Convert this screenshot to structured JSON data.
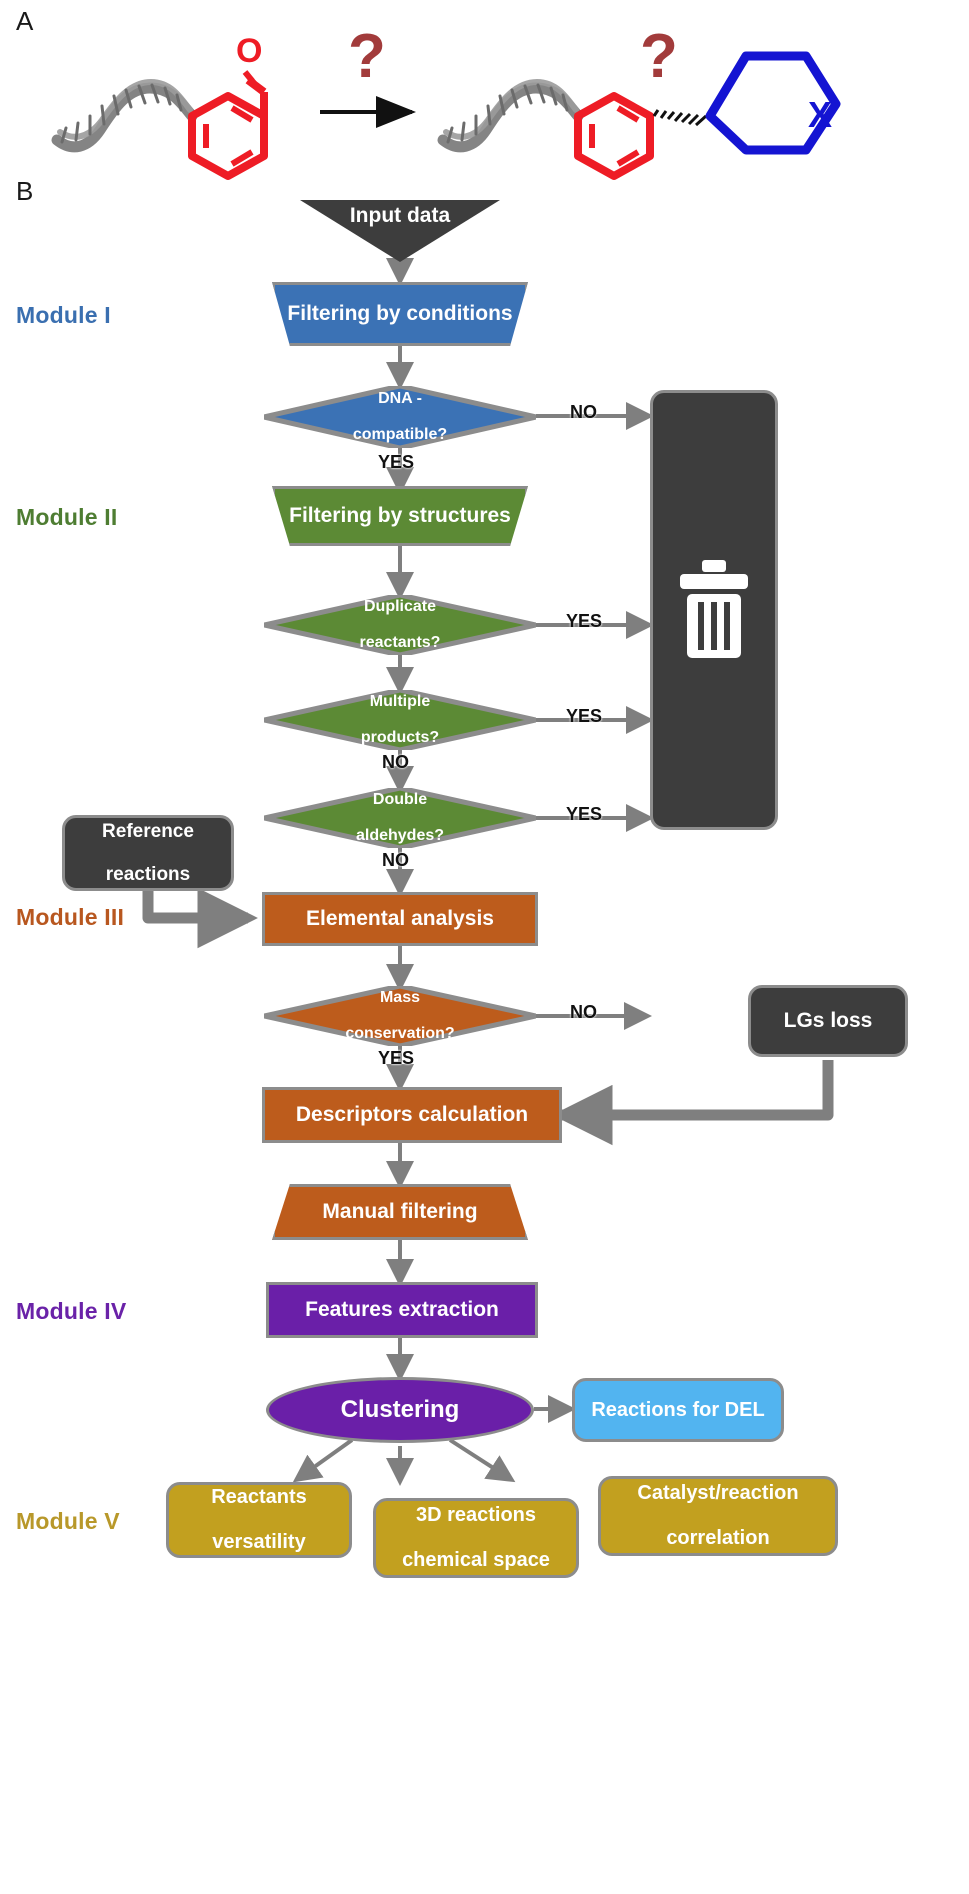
{
  "figure": {
    "panel_a_letter": "A",
    "panel_b_letter": "B"
  },
  "panel_a": {
    "reactant_label": "DNA-conjugated benzaldehyde",
    "question_mark_left": "?",
    "question_mark_right": "?",
    "heteroatom_label": "X",
    "arrow": "reaction-arrow",
    "colors": {
      "aryl_red": "#ee1c25",
      "ring_blue": "#1414d2",
      "question_red": "#a23b3b",
      "dna_gray": "#6e6e6e"
    }
  },
  "panel_b": {
    "modules": [
      {
        "id": "I",
        "label": "Module I",
        "color": "#3a6fb0"
      },
      {
        "id": "II",
        "label": "Module II",
        "color": "#4e7d32"
      },
      {
        "id": "III",
        "label": "Module III",
        "color": "#b8571f"
      },
      {
        "id": "IV",
        "label": "Module IV",
        "color": "#6a22a8"
      },
      {
        "id": "V",
        "label": "Module V",
        "color": "#b8982a"
      }
    ],
    "nodes": {
      "input_data": "Input data",
      "filtering_conditions": "Filtering by conditions",
      "dna_compatible": "DNA -\ncompatible?",
      "dna_compatible_line1": "DNA -",
      "dna_compatible_line2": "compatible?",
      "filtering_structures": "Filtering by structures",
      "duplicate_line1": "Duplicate",
      "duplicate_line2": "reactants?",
      "multiple_line1": "Multiple",
      "multiple_line2": "products?",
      "double_line1": "Double",
      "double_line2": "aldehydes?",
      "reference_line1": "Reference",
      "reference_line2": "reactions",
      "elemental_analysis": "Elemental analysis",
      "mass_line1": "Mass",
      "mass_line2": "conservation?",
      "lgs_loss": "LGs loss",
      "descriptors_calculation": "Descriptors calculation",
      "manual_filtering": "Manual filtering",
      "features_extraction": "Features extraction",
      "clustering": "Clustering",
      "reactions_for_del": "Reactions for DEL",
      "reactants_line1": "Reactants",
      "reactants_line2": "versatility",
      "space_line1": "3D reactions",
      "space_line2": "chemical space",
      "catalyst_line1": "Catalyst/reaction",
      "catalyst_line2": "correlation",
      "trash_icon": "trash-bin-icon"
    },
    "edge_labels": {
      "dna_no": "NO",
      "dna_yes": "YES",
      "duplicate_yes": "YES",
      "multiple_yes": "YES",
      "multiple_no": "NO",
      "double_yes": "YES",
      "double_no": "NO",
      "mass_no": "NO",
      "mass_yes": "YES"
    },
    "colors": {
      "dark_gray": "#3d3d3d",
      "blue": "#3b72b5",
      "green": "#5c8a35",
      "orange": "#bd5c1c",
      "purple": "#6a1fa8",
      "light_blue": "#52b4f0",
      "gold": "#c2a01f",
      "outline": "#8c8c8c",
      "arrow": "#7f7f7f"
    }
  }
}
